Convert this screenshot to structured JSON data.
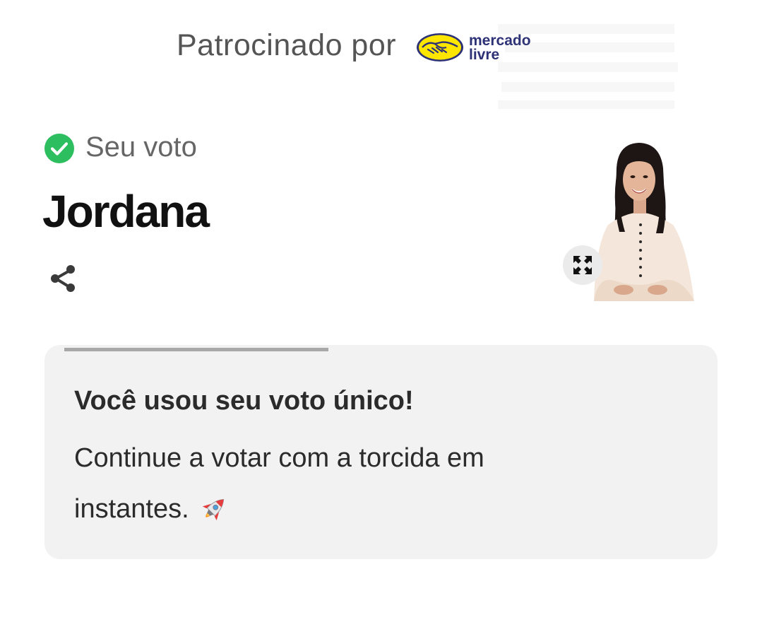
{
  "sponsor": {
    "label": "Patrocinado por",
    "logo_text_line1": "mercado",
    "logo_text_line2": "livre",
    "brand_colors": {
      "yellow": "#FFE600",
      "blue": "#2D3277"
    }
  },
  "vote": {
    "status_icon": "check-circle-icon",
    "status_label": "Seu voto",
    "status_color": "#2DBE60",
    "candidate_name": "Jordana",
    "share_icon": "share-icon",
    "expand_icon": "expand-icon"
  },
  "notice": {
    "title": "Você usou seu voto único!",
    "body": "Continue a votar com a torcida em instantes.",
    "emoji_icon": "rocket-icon",
    "progress": 0.42
  }
}
